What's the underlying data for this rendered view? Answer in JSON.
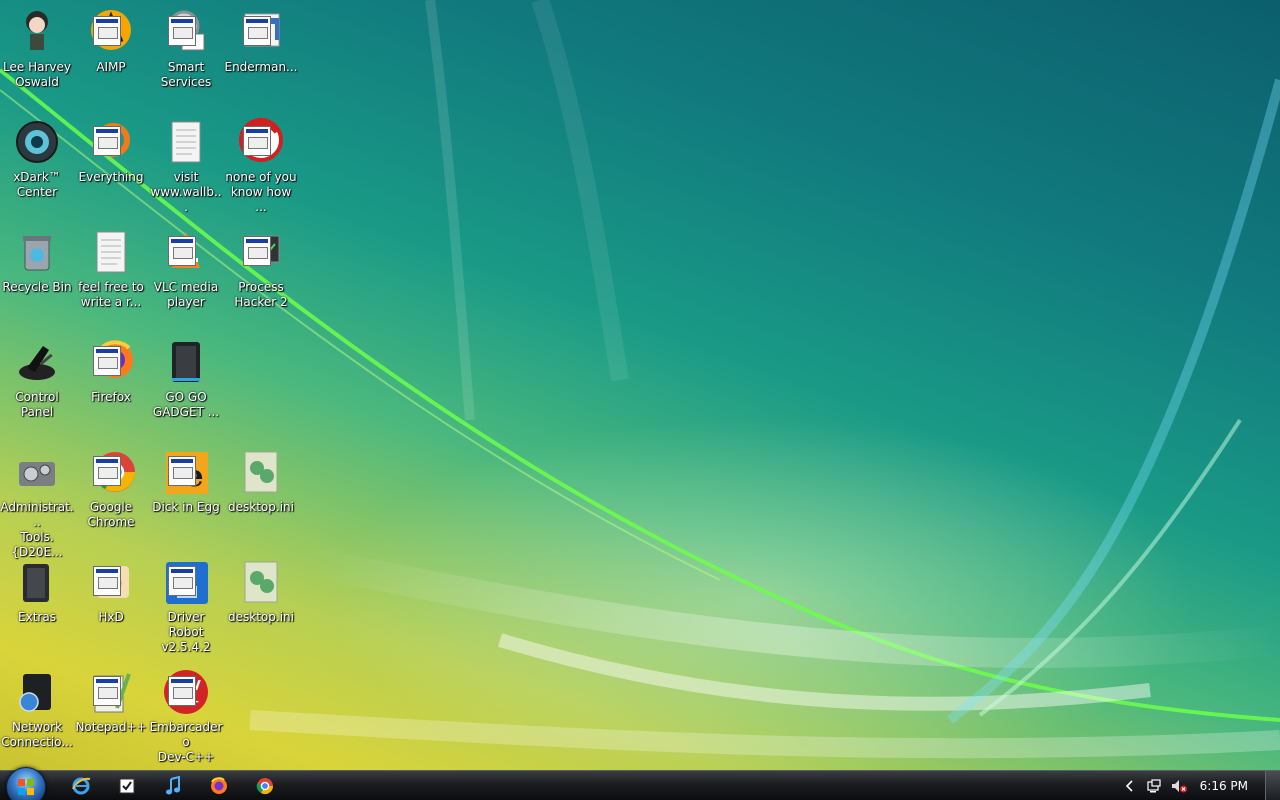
{
  "desktop_icons": [
    {
      "label": "Lee Harvey\nOswald",
      "icon": "anime-girl-icon"
    },
    {
      "label": "xDark™\nCenter",
      "icon": "xdark-center-icon"
    },
    {
      "label": "Recycle Bin",
      "icon": "recycle-bin-icon"
    },
    {
      "label": "Control\nPanel",
      "icon": "control-panel-icon"
    },
    {
      "label": "Administrat...\nTools.{D20E...",
      "icon": "admin-tools-icon"
    },
    {
      "label": "Extras",
      "icon": "folder-extras-icon"
    },
    {
      "label": "Network\nConnectio...",
      "icon": "network-connections-icon"
    },
    {
      "label": "AIMP",
      "icon": "aimp-icon"
    },
    {
      "label": "Everything",
      "icon": "everything-icon"
    },
    {
      "label": "feel free to\nwrite a r...",
      "icon": "text-file-icon"
    },
    {
      "label": "Firefox",
      "icon": "firefox-icon"
    },
    {
      "label": "Google\nChrome",
      "icon": "chrome-icon"
    },
    {
      "label": "HxD",
      "icon": "hxd-icon"
    },
    {
      "label": "Notepad++",
      "icon": "notepadpp-icon"
    },
    {
      "label": "Smart\nServices",
      "icon": "smart-services-icon"
    },
    {
      "label": "visit\nwww.wallb...",
      "icon": "text-file-icon"
    },
    {
      "label": "VLC media\nplayer",
      "icon": "vlc-icon"
    },
    {
      "label": "GO GO\nGADGET ...",
      "icon": "gadget-folder-icon"
    },
    {
      "label": "Dick in Egg",
      "icon": "dick-in-egg-icon"
    },
    {
      "label": "Driver Robot\nv2.5.4.2",
      "icon": "driver-robot-icon"
    },
    {
      "label": "Embarcadero\nDev-C++",
      "icon": "devcpp-icon"
    },
    {
      "label": "Enderman...",
      "icon": "enderman-icon"
    },
    {
      "label": "none of you\nknow how ...",
      "icon": "red-circle-icon"
    },
    {
      "label": "Process\nHacker 2",
      "icon": "process-hacker-icon"
    },
    {
      "label": "desktop.ini",
      "icon": "ini-file-icon"
    },
    {
      "label": "desktop.ini",
      "icon": "ini-file-icon"
    }
  ],
  "taskbar": {
    "pinned": [
      "internet-explorer-icon",
      "tasks-icon",
      "music-icon",
      "firefox-icon",
      "chrome-icon"
    ],
    "tray": [
      "chevron-left-icon",
      "network-icon",
      "volume-muted-icon"
    ],
    "clock": "6:16 PM"
  }
}
